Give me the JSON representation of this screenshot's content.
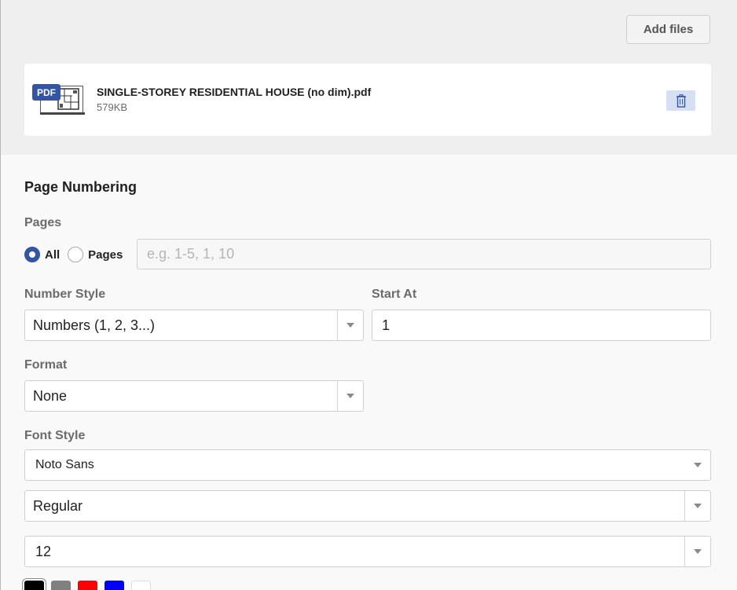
{
  "toolbar": {
    "add_files_label": "Add files"
  },
  "file": {
    "badge": "PDF",
    "name": "SINGLE-STOREY RESIDENTIAL HOUSE (no dim).pdf",
    "size": "579KB",
    "thumbnail_icon": "pdf-thumbnail",
    "delete_icon": "trash-icon"
  },
  "page_numbering": {
    "title": "Page Numbering",
    "pages_label": "Pages",
    "pages_options": [
      {
        "label": "All",
        "checked": true
      },
      {
        "label": "Pages",
        "checked": false
      }
    ],
    "pages_input_placeholder": "e.g. 1-5, 1, 10",
    "number_style_label": "Number Style",
    "number_style_value": "Numbers (1, 2, 3...)",
    "start_at_label": "Start At",
    "start_at_value": "1",
    "format_label": "Format",
    "format_value": "None",
    "font_style_label": "Font Style",
    "font_family_value": "Noto Sans",
    "font_weight_value": "Regular",
    "font_size_value": "12",
    "colors": [
      "#000000",
      "#808080",
      "#ff0000",
      "#0000ff",
      "#ffffff"
    ]
  },
  "accent_color": "#3455a6"
}
